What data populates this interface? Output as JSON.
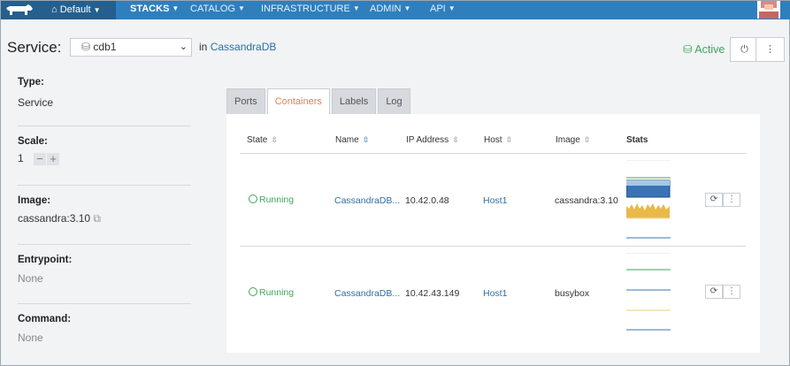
{
  "nav": {
    "environment": "Default",
    "items": [
      {
        "label": "STACKS",
        "active": true
      },
      {
        "label": "CATALOG",
        "active": false
      },
      {
        "label": "INFRASTRUCTURE",
        "active": false
      },
      {
        "label": "ADMIN",
        "active": false
      },
      {
        "label": "API",
        "active": false
      }
    ]
  },
  "header": {
    "title": "Service:",
    "service_name": "cdb1",
    "in_prefix": "in",
    "stack_name": "CassandraDB",
    "status": "Active"
  },
  "sidebar": {
    "type_label": "Type:",
    "type_value": "Service",
    "scale_label": "Scale:",
    "scale_value": "1",
    "image_label": "Image:",
    "image_value": "cassandra:3.10",
    "entrypoint_label": "Entrypoint:",
    "entrypoint_value": "None",
    "command_label": "Command:",
    "command_value": "None"
  },
  "tabs": [
    "Ports",
    "Containers",
    "Labels",
    "Log"
  ],
  "active_tab": "Containers",
  "table": {
    "headers": [
      "State",
      "Name",
      "IP Address",
      "Host",
      "Image",
      "Stats"
    ],
    "rows": [
      {
        "state": "Running",
        "name": "CassandraDB...",
        "ip": "10.42.0.48",
        "host": "Host1",
        "image": "cassandra:3.10"
      },
      {
        "state": "Running",
        "name": "CassandraDB...",
        "ip": "10.42.43.149",
        "host": "Host1",
        "image": "busybox"
      }
    ]
  },
  "colors": {
    "nav_bg": "#2f7fbd",
    "accent_active_tab": "#e8804a",
    "status_green": "#41a65a",
    "link_blue": "#2d6ea3"
  }
}
